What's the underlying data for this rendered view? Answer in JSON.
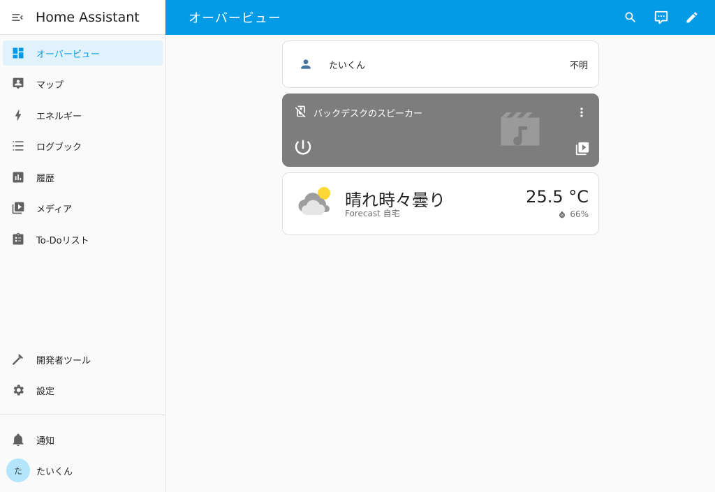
{
  "app": {
    "title": "Home Assistant"
  },
  "header": {
    "title": "オーバービュー"
  },
  "sidebar": {
    "items": [
      {
        "label": "オーバービュー",
        "icon": "dashboard-icon",
        "active": true
      },
      {
        "label": "マップ",
        "icon": "map-icon"
      },
      {
        "label": "エネルギー",
        "icon": "energy-icon"
      },
      {
        "label": "ログブック",
        "icon": "logbook-icon"
      },
      {
        "label": "履歴",
        "icon": "history-icon"
      },
      {
        "label": "メディア",
        "icon": "media-icon"
      },
      {
        "label": "To-Doリスト",
        "icon": "todo-icon"
      }
    ],
    "bottom": [
      {
        "label": "開発者ツール",
        "icon": "hammer-icon"
      },
      {
        "label": "設定",
        "icon": "gear-icon"
      }
    ],
    "notifications_label": "通知",
    "user": {
      "name": "たいくん",
      "avatar_text": "た"
    }
  },
  "cards": {
    "person": {
      "name": "たいくん",
      "state": "不明"
    },
    "media": {
      "title": "バックデスクのスピーカー"
    },
    "weather": {
      "condition": "晴れ時々曇り",
      "name": "Forecast 自宅",
      "temperature": "25.5 °C",
      "humidity": "66%"
    }
  },
  "colors": {
    "accent": "#039be5",
    "active_bg": "#e1f2fd",
    "media_card": "#7d7d7d"
  }
}
